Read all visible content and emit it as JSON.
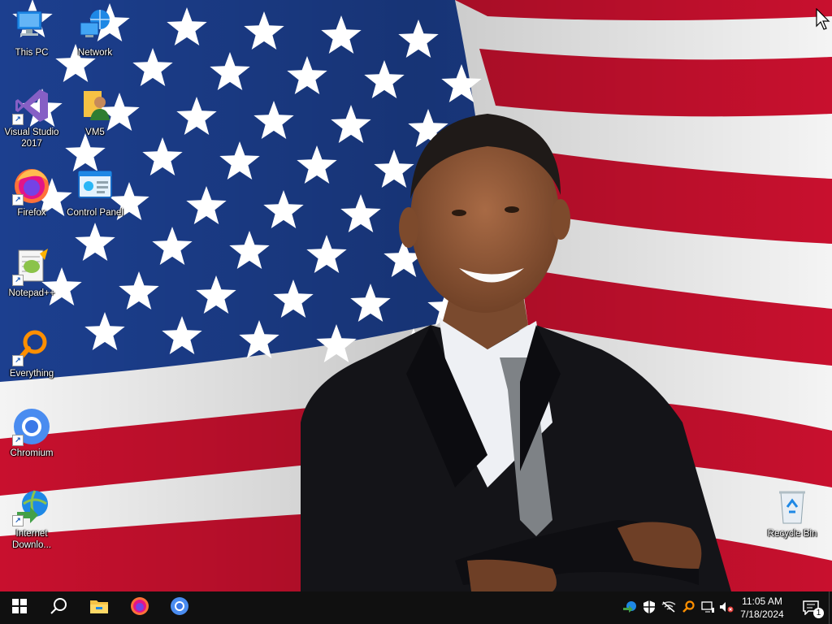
{
  "desktop": {
    "icons": [
      {
        "label": "This PC",
        "icon": "computer-icon"
      },
      {
        "label": "Network",
        "icon": "network-icon"
      },
      {
        "label": "Visual Studio 2017",
        "icon": "visual-studio-icon"
      },
      {
        "label": "VM5",
        "icon": "user-folder-icon"
      },
      {
        "label": "Firefox",
        "icon": "firefox-icon"
      },
      {
        "label": "Control Panel",
        "icon": "control-panel-icon"
      },
      {
        "label": "Notepad++",
        "icon": "notepadpp-icon"
      },
      {
        "label": "Everything",
        "icon": "everything-search-icon"
      },
      {
        "label": "Chromium",
        "icon": "chromium-icon"
      },
      {
        "label": "Internet Downlo...",
        "icon": "idm-icon"
      },
      {
        "label": "Recycle Bin",
        "icon": "recycle-bin-icon"
      }
    ]
  },
  "taskbar": {
    "start": "windows-start-icon",
    "search": "search-icon",
    "pinned": [
      "file-explorer-icon",
      "firefox-icon",
      "chromium-icon"
    ],
    "tray": [
      "idm-tray-icon",
      "security-shield-icon",
      "network-disconnected-icon",
      "everything-tray-icon",
      "network-icon",
      "volume-muted-icon"
    ],
    "clock": {
      "time": "11:05 AM",
      "date": "7/18/2024"
    },
    "notifications": {
      "count": "1"
    }
  },
  "colors": {
    "flag_red": "#c8102e",
    "flag_blue": "#1c3f8f",
    "taskbar": "#101010"
  }
}
